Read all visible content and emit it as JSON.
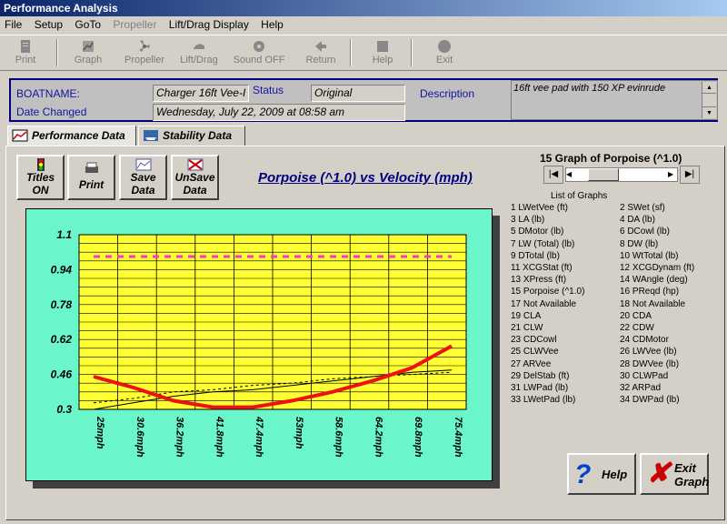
{
  "window": {
    "title": "Performance Analysis"
  },
  "menu": [
    "File",
    "Setup",
    "GoTo",
    "Propeller",
    "Lift/Drag Display",
    "Help"
  ],
  "toolbar": [
    {
      "label": "Print",
      "icon": "print-icon"
    },
    {
      "label": "Graph",
      "icon": "graph-icon"
    },
    {
      "label": "Propeller",
      "icon": "propeller-icon"
    },
    {
      "label": "Lift/Drag",
      "icon": "lift-drag-icon"
    },
    {
      "label": "Sound OFF",
      "icon": "sound-icon"
    },
    {
      "label": "Return",
      "icon": "return-icon"
    },
    {
      "label": "Help",
      "icon": "help-icon"
    },
    {
      "label": "Exit",
      "icon": "exit-icon"
    }
  ],
  "info": {
    "boatname_label": "BOATNAME:",
    "boatname": "Charger 16ft Vee-I",
    "status_label": "Status",
    "status": "Original",
    "description_label": "Description",
    "description": "16ft vee pad with 150 XP evinrude",
    "date_label": "Date Changed",
    "date": "Wednesday, July 22, 2009 at 08:58 am"
  },
  "tabs": [
    "Performance Data",
    "Stability Data"
  ],
  "buttons": {
    "titles_line1": "Titles",
    "titles_line2": "ON",
    "print": "Print",
    "save_line1": "Save",
    "save_line2": "Data",
    "unsave_line1": "UnSave",
    "unsave_line2": "Data",
    "help": "Help",
    "exit_line1": "Exit",
    "exit_line2": "Graph"
  },
  "chart_title": "Porpoise (^1.0) vs Velocity (mph)",
  "graph_selector_title": "15 Graph of Porpoise (^1.0)",
  "list_title": "List of Graphs",
  "graph_list": [
    "1 LWetVee (ft)",
    "2 SWet (sf)",
    "3 LA (lb)",
    "4 DA (lb)",
    "5 DMotor (lb)",
    "6 DCowl (lb)",
    "7 LW (Total) (lb)",
    "8 DW (lb)",
    "9 DTotal (lb)",
    "10 WtTotal (lb)",
    "11 XCGStat (ft)",
    "12 XCGDynam (ft)",
    "13 XPress (ft)",
    "14 WAngle (deg)",
    "15 Porpoise (^1.0)",
    "16 PReqd (hp)",
    "17 Not Available",
    "18 Not Available",
    "19 CLA",
    "20 CDA",
    "21 CLW",
    "22 CDW",
    "23 CDCowl",
    "24 CDMotor",
    "25 CLWVee",
    "26 LWVee (lb)",
    "27 ARVee",
    "28 DWVee (lb)",
    "29 DelStab (ft)",
    "30 CLWPad",
    "31 LWPad (lb)",
    "32 ARPad",
    "33 LWetPad (lb)",
    "34 DWPad (lb)"
  ],
  "colors": {
    "plot_bg": "#ffff33",
    "frame_bg": "#6af5ca",
    "curve": "#ee1111",
    "ref": "#ff33cc"
  },
  "chart_data": {
    "type": "line",
    "title": "Porpoise (^1.0) vs Velocity (mph)",
    "x": [
      "25mph",
      "30.6mph",
      "36.2mph",
      "41.8mph",
      "47.4mph",
      "53mph",
      "58.6mph",
      "64.2mph",
      "69.8mph",
      "75.4mph"
    ],
    "x_values": [
      25,
      30.6,
      36.2,
      41.8,
      47.4,
      53,
      58.6,
      64.2,
      69.8,
      75.4
    ],
    "yticks": [
      "1.1",
      "0.94",
      "0.78",
      "0.62",
      "0.46",
      "0.3"
    ],
    "ylim": [
      0.3,
      1.1
    ],
    "grid": true,
    "series": [
      {
        "style": "thick-red",
        "values": [
          0.45,
          0.4,
          0.34,
          0.31,
          0.31,
          0.34,
          0.38,
          0.43,
          0.49,
          0.59
        ]
      },
      {
        "style": "dashed-pink",
        "values": [
          1.0,
          1.0,
          1.0,
          1.0,
          1.0,
          1.0,
          1.0,
          1.0,
          1.0,
          1.0
        ]
      },
      {
        "style": "thin-black",
        "values": [
          0.3,
          0.33,
          0.36,
          0.38,
          0.39,
          0.41,
          0.43,
          0.45,
          0.47,
          0.48
        ]
      },
      {
        "style": "dotted-black",
        "values": [
          0.33,
          0.35,
          0.38,
          0.39,
          0.41,
          0.42,
          0.44,
          0.45,
          0.46,
          0.47
        ]
      }
    ]
  }
}
